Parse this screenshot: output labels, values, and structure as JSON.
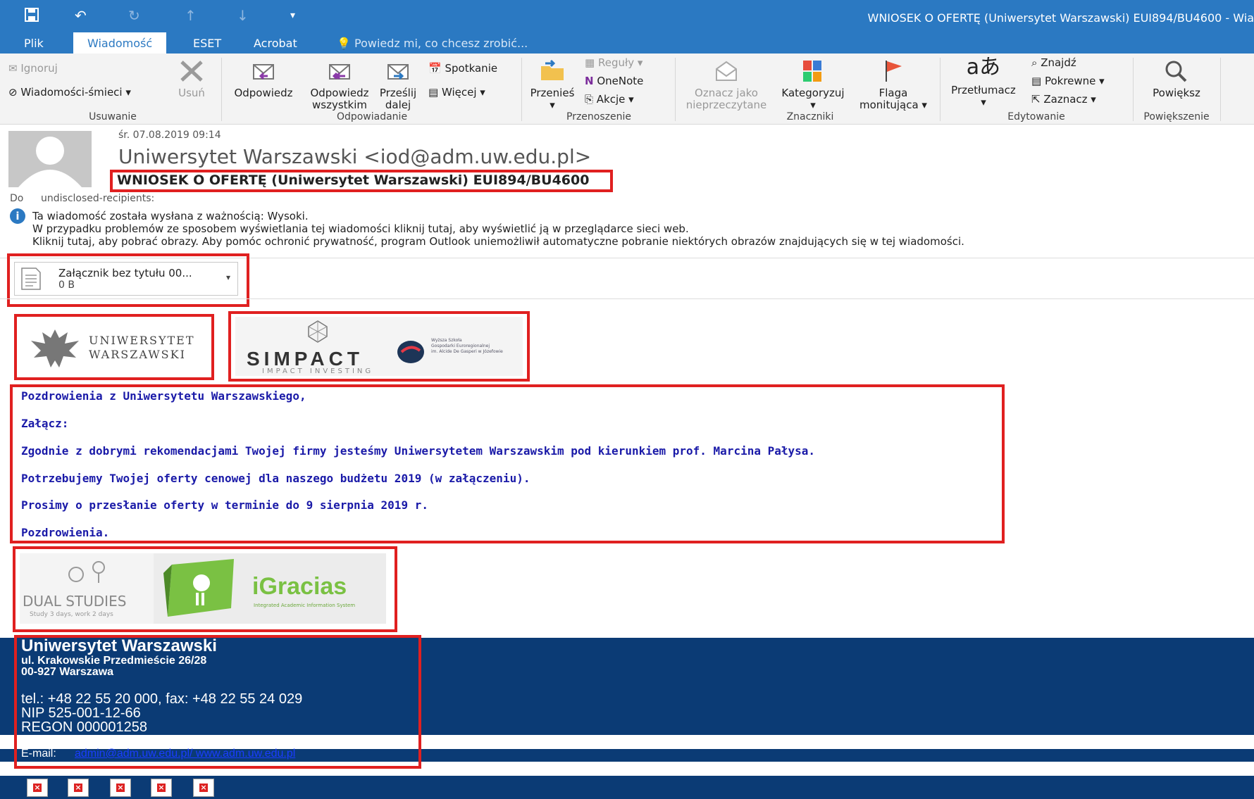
{
  "window": {
    "title": "WNIOSEK O OFERTĘ (Uniwersytet Warszawski) EUI894/BU4600  -  Wia"
  },
  "tabs": [
    {
      "label": "Plik"
    },
    {
      "label": "Wiadomość"
    },
    {
      "label": "ESET"
    },
    {
      "label": "Acrobat"
    }
  ],
  "tell_me": "Powiedz mi, co chcesz zrobić...",
  "ribbon": {
    "usuwanie": {
      "label": "Usuwanie",
      "ignoruj": "Ignoruj",
      "smieci": "Wiadomości-śmieci ▾",
      "usun": "Usuń"
    },
    "odpowiadanie": {
      "label": "Odpowiadanie",
      "odpowiedz": "Odpowiedz",
      "odpowiedz_wszystkim_1": "Odpowiedz",
      "odpowiedz_wszystkim_2": "wszystkim",
      "przeslij_1": "Prześlij",
      "przeslij_2": "dalej",
      "spotkanie": "Spotkanie",
      "wiecej": "Więcej ▾"
    },
    "przenoszenie": {
      "label": "Przenoszenie",
      "przenies": "Przenieś",
      "reguly": "Reguły ▾",
      "onenote": "OneNote",
      "akcje": "Akcje ▾"
    },
    "znaczniki": {
      "label": "Znaczniki",
      "oznacz_1": "Oznacz jako",
      "oznacz_2": "nieprzeczytane",
      "kategoryzuj": "Kategoryzuj",
      "flaga_1": "Flaga",
      "flaga_2": "monitująca ▾"
    },
    "edytowanie": {
      "label": "Edytowanie",
      "przetlumacz": "Przetłumacz",
      "znajdz": "Znajdź",
      "pokrewne": "Pokrewne ▾",
      "zaznacz": "Zaznacz ▾"
    },
    "powiekszenie": {
      "label": "Powiększenie",
      "powieksz": "Powiększ"
    }
  },
  "message": {
    "date": "śr. 07.08.2019 09:14",
    "sender": "Uniwersytet Warszawski <iod@adm.uw.edu.pl>",
    "subject": "WNIOSEK O OFERTĘ (Uniwersytet Warszawski) EUI894/BU4600",
    "to_label": "Do",
    "to": "undisclosed-recipients:",
    "info_1": "Ta wiadomość została wysłana z ważnością: Wysoki.",
    "info_2": "W przypadku problemów ze sposobem wyświetlania tej wiadomości kliknij tutaj, aby wyświetlić ją w przeglądarce sieci web.",
    "info_3": "Kliknij tutaj, aby pobrać obrazy. Aby pomóc ochronić prywatność, program Outlook uniemożliwił automatyczne pobranie niektórych obrazów znajdujących się w tej wiadomości."
  },
  "attachment": {
    "name": "Załącznik bez tytułu 00...",
    "size": "0 B"
  },
  "logos": {
    "uw_1": "UNIWERSYTET",
    "uw_2": "WARSZAWSKI",
    "simpact": "SIMPACT",
    "simpact_sub": "IMPACT INVESTING",
    "wsge_1": "Wyższa Szkoła",
    "wsge_2": "Gospodarki Euroregionalnej",
    "wsge_3": "im. Alcide De Gasperi w Józefowie",
    "dual": "DUAL STUDIES",
    "dual_sub": "Study 3 days, work 2 days",
    "igracias": "iGracias",
    "igracias_sub": "Integrated Academic Information System"
  },
  "body": [
    "Pozdrowienia z Uniwersytetu Warszawskiego,",
    "Załącz:",
    "Zgodnie z dobrymi rekomendacjami Twojej firmy jesteśmy Uniwersytetem Warszawskim pod kierunkiem prof. Marcina Pałysa.",
    "Potrzebujemy Twojej oferty cenowej dla naszego budżetu 2019 (w załączeniu).",
    "Prosimy o przesłanie oferty w terminie do 9 sierpnia 2019 r.",
    "Pozdrowienia."
  ],
  "signature": {
    "name": "Uniwersytet Warszawski",
    "addr_1": "ul. Krakowskie Przedmieście 26/28",
    "addr_2": "00-927 Warszawa",
    "tel": "tel.: +48 22 55 20 000, fax: +48 22 55 24 029",
    "nip": "NIP 525-001-12-66",
    "regon": "REGON 000001258",
    "email_label": "E-mail:",
    "email_links": "admin@adm.uw.edu.pl/ www.adm.uw.edu.pl"
  },
  "colors": {
    "accent": "#2b79c2",
    "signature_bg": "#0b3b75",
    "highlight": "#e02020",
    "body_text": "#1a1aa8"
  }
}
